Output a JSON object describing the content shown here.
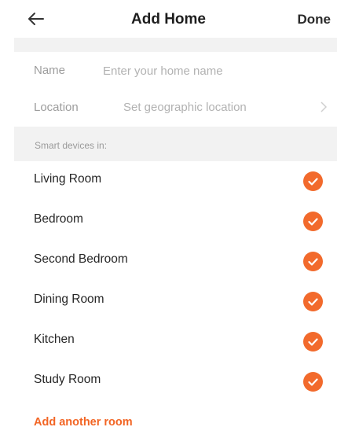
{
  "header": {
    "title": "Add Home",
    "done_label": "Done",
    "back_icon": "arrow-left-icon"
  },
  "form": {
    "name": {
      "label": "Name",
      "placeholder": "Enter your home name",
      "value": ""
    },
    "location": {
      "label": "Location",
      "value": "Set geographic location",
      "icon": "chevron-right-icon"
    }
  },
  "rooms_section": {
    "label": "Smart devices in:",
    "rooms": [
      {
        "label": "Living Room",
        "checked": true
      },
      {
        "label": "Bedroom",
        "checked": true
      },
      {
        "label": "Second Bedroom",
        "checked": true
      },
      {
        "label": "Dining Room",
        "checked": true
      },
      {
        "label": "Kitchen",
        "checked": true
      },
      {
        "label": "Study Room",
        "checked": true
      }
    ],
    "add_room_label": "Add another room"
  },
  "colors": {
    "accent": "#f26a2c",
    "section_background": "#f2f2f2"
  }
}
